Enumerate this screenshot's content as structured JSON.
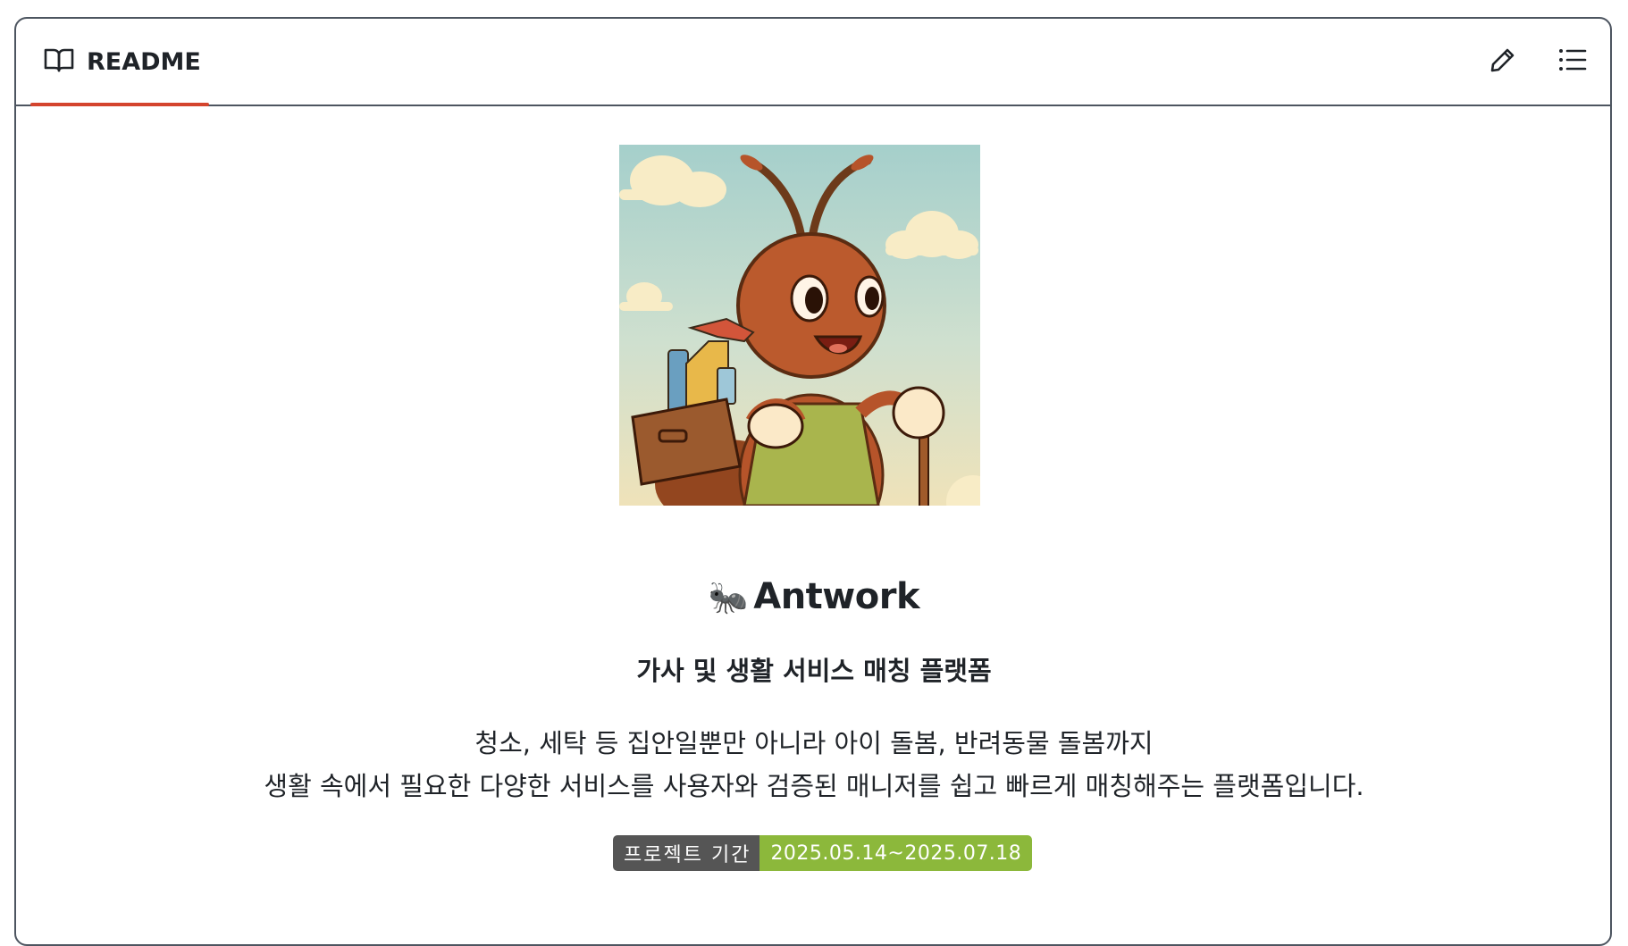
{
  "readme": {
    "tab_label": "README",
    "title_emoji": "🐜",
    "title": "Antwork",
    "subtitle": "가사 및 생활 서비스 매칭 플랫폼",
    "description_line1": "청소, 세탁 등 집안일뿐만 아니라 아이 돌봄, 반려동물 돌봄까지",
    "description_line2": "생활 속에서 필요한 다양한 서비스를 사용자와 검증된 매니저를 쉽고 빠르게 매칭해주는 플랫폼입니다.",
    "badge": {
      "label": "프로젝트 기간",
      "value": "2025.05.14~2025.07.18",
      "label_color": "#555555",
      "value_color": "#8cb83b"
    }
  },
  "colors": {
    "accent_underline": "#d4442e",
    "border": "#4d5560",
    "text": "#1f2328"
  },
  "icons": {
    "tab": "book-icon",
    "edit": "pencil-icon",
    "outline": "list-icon"
  }
}
